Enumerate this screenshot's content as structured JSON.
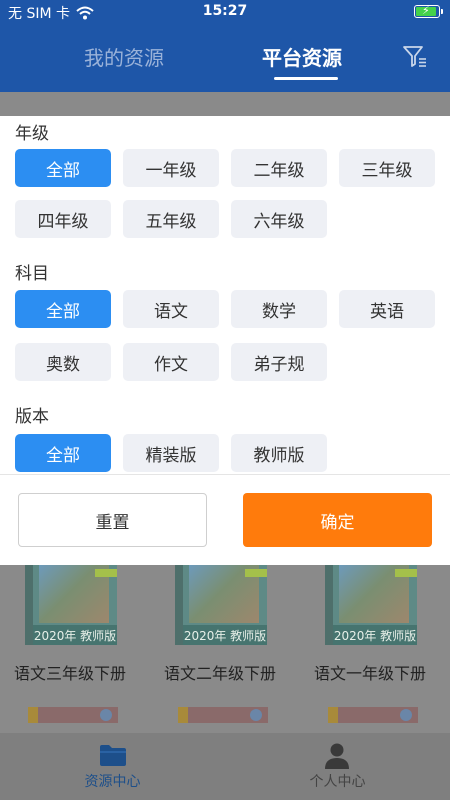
{
  "status_bar": {
    "carrier": "无 SIM 卡",
    "time": "15:27"
  },
  "header": {
    "tabs": [
      {
        "label": "我的资源",
        "active": false
      },
      {
        "label": "平台资源",
        "active": true
      }
    ],
    "filter_icon": "filter-icon"
  },
  "filter": {
    "grade": {
      "title": "年级",
      "options": [
        "全部",
        "一年级",
        "二年级",
        "三年级",
        "四年级",
        "五年级",
        "六年级"
      ],
      "selected": "全部"
    },
    "subject": {
      "title": "科目",
      "options": [
        "全部",
        "语文",
        "数学",
        "英语",
        "奥数",
        "作文",
        "弟子规"
      ],
      "selected": "全部"
    },
    "edition": {
      "title": "版本",
      "options": [
        "全部",
        "精装版",
        "教师版"
      ],
      "selected": "全部"
    },
    "reset_label": "重置",
    "confirm_label": "确定"
  },
  "books": [
    {
      "title": "语文三年级下册",
      "edition_label": "2020年 教师版"
    },
    {
      "title": "语文二年级下册",
      "edition_label": "2020年 教师版"
    },
    {
      "title": "语文一年级下册",
      "edition_label": "2020年 教师版"
    }
  ],
  "bottom_nav": [
    {
      "label": "资源中心",
      "icon": "folder-icon",
      "active": true
    },
    {
      "label": "个人中心",
      "icon": "user-icon",
      "active": false
    }
  ],
  "colors": {
    "primary": "#1e56a8",
    "selected_option": "#2c8ef2",
    "confirm": "#ff7b0c"
  }
}
